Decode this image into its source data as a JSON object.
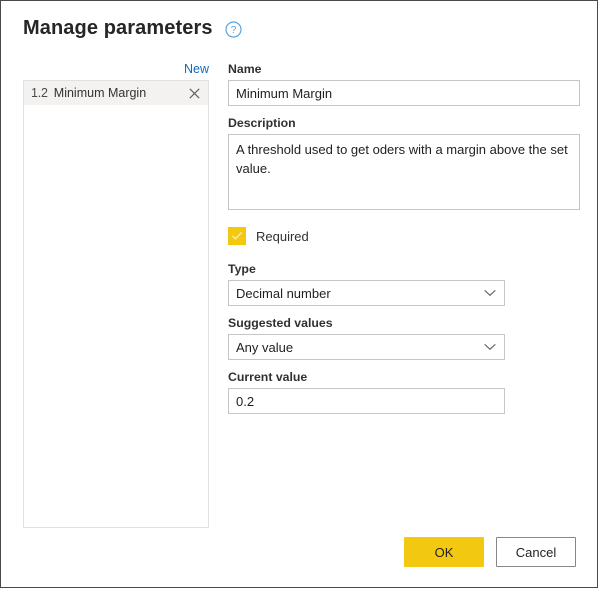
{
  "dialog": {
    "title": "Manage parameters",
    "help_icon": "help-circle-icon"
  },
  "left_panel": {
    "new_label": "New",
    "items": [
      {
        "type_icon": "1.2",
        "label": "Minimum Margin",
        "remove_icon": "close-icon"
      }
    ]
  },
  "form": {
    "name": {
      "label": "Name",
      "value": "Minimum Margin",
      "placeholder": ""
    },
    "description": {
      "label": "Description",
      "value": "A threshold used to get oders with a margin above the set value.",
      "placeholder": ""
    },
    "required": {
      "label": "Required",
      "checked": true,
      "check_icon": "checkmark-icon"
    },
    "type": {
      "label": "Type",
      "value": "Decimal number",
      "chevron_icon": "chevron-down-icon"
    },
    "suggested_values": {
      "label": "Suggested values",
      "value": "Any value",
      "chevron_icon": "chevron-down-icon"
    },
    "current_value": {
      "label": "Current value",
      "value": "0.2",
      "placeholder": ""
    }
  },
  "footer": {
    "ok_label": "OK",
    "cancel_label": "Cancel"
  },
  "colors": {
    "accent": "#f2c811",
    "link": "#0f6cbd",
    "border": "#c8c6c4",
    "selected_row": "#f3f2f1"
  }
}
